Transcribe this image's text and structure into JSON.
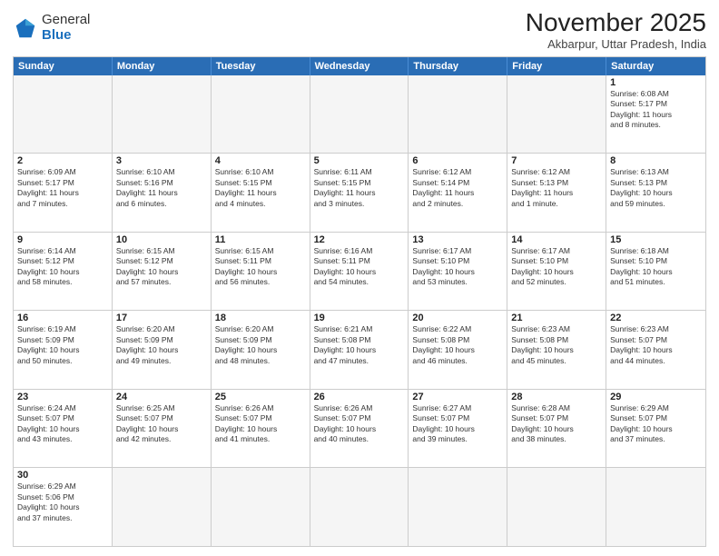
{
  "header": {
    "logo_general": "General",
    "logo_blue": "Blue",
    "month_title": "November 2025",
    "location": "Akbarpur, Uttar Pradesh, India"
  },
  "day_headers": [
    "Sunday",
    "Monday",
    "Tuesday",
    "Wednesday",
    "Thursday",
    "Friday",
    "Saturday"
  ],
  "weeks": [
    {
      "days": [
        {
          "num": "",
          "info": "",
          "empty": true
        },
        {
          "num": "",
          "info": "",
          "empty": true
        },
        {
          "num": "",
          "info": "",
          "empty": true
        },
        {
          "num": "",
          "info": "",
          "empty": true
        },
        {
          "num": "",
          "info": "",
          "empty": true
        },
        {
          "num": "",
          "info": "",
          "empty": true
        },
        {
          "num": "1",
          "info": "Sunrise: 6:08 AM\nSunset: 5:17 PM\nDaylight: 11 hours\nand 8 minutes.",
          "empty": false
        }
      ]
    },
    {
      "days": [
        {
          "num": "2",
          "info": "Sunrise: 6:09 AM\nSunset: 5:17 PM\nDaylight: 11 hours\nand 7 minutes.",
          "empty": false
        },
        {
          "num": "3",
          "info": "Sunrise: 6:10 AM\nSunset: 5:16 PM\nDaylight: 11 hours\nand 6 minutes.",
          "empty": false
        },
        {
          "num": "4",
          "info": "Sunrise: 6:10 AM\nSunset: 5:15 PM\nDaylight: 11 hours\nand 4 minutes.",
          "empty": false
        },
        {
          "num": "5",
          "info": "Sunrise: 6:11 AM\nSunset: 5:15 PM\nDaylight: 11 hours\nand 3 minutes.",
          "empty": false
        },
        {
          "num": "6",
          "info": "Sunrise: 6:12 AM\nSunset: 5:14 PM\nDaylight: 11 hours\nand 2 minutes.",
          "empty": false
        },
        {
          "num": "7",
          "info": "Sunrise: 6:12 AM\nSunset: 5:13 PM\nDaylight: 11 hours\nand 1 minute.",
          "empty": false
        },
        {
          "num": "8",
          "info": "Sunrise: 6:13 AM\nSunset: 5:13 PM\nDaylight: 10 hours\nand 59 minutes.",
          "empty": false
        }
      ]
    },
    {
      "days": [
        {
          "num": "9",
          "info": "Sunrise: 6:14 AM\nSunset: 5:12 PM\nDaylight: 10 hours\nand 58 minutes.",
          "empty": false
        },
        {
          "num": "10",
          "info": "Sunrise: 6:15 AM\nSunset: 5:12 PM\nDaylight: 10 hours\nand 57 minutes.",
          "empty": false
        },
        {
          "num": "11",
          "info": "Sunrise: 6:15 AM\nSunset: 5:11 PM\nDaylight: 10 hours\nand 56 minutes.",
          "empty": false
        },
        {
          "num": "12",
          "info": "Sunrise: 6:16 AM\nSunset: 5:11 PM\nDaylight: 10 hours\nand 54 minutes.",
          "empty": false
        },
        {
          "num": "13",
          "info": "Sunrise: 6:17 AM\nSunset: 5:10 PM\nDaylight: 10 hours\nand 53 minutes.",
          "empty": false
        },
        {
          "num": "14",
          "info": "Sunrise: 6:17 AM\nSunset: 5:10 PM\nDaylight: 10 hours\nand 52 minutes.",
          "empty": false
        },
        {
          "num": "15",
          "info": "Sunrise: 6:18 AM\nSunset: 5:10 PM\nDaylight: 10 hours\nand 51 minutes.",
          "empty": false
        }
      ]
    },
    {
      "days": [
        {
          "num": "16",
          "info": "Sunrise: 6:19 AM\nSunset: 5:09 PM\nDaylight: 10 hours\nand 50 minutes.",
          "empty": false
        },
        {
          "num": "17",
          "info": "Sunrise: 6:20 AM\nSunset: 5:09 PM\nDaylight: 10 hours\nand 49 minutes.",
          "empty": false
        },
        {
          "num": "18",
          "info": "Sunrise: 6:20 AM\nSunset: 5:09 PM\nDaylight: 10 hours\nand 48 minutes.",
          "empty": false
        },
        {
          "num": "19",
          "info": "Sunrise: 6:21 AM\nSunset: 5:08 PM\nDaylight: 10 hours\nand 47 minutes.",
          "empty": false
        },
        {
          "num": "20",
          "info": "Sunrise: 6:22 AM\nSunset: 5:08 PM\nDaylight: 10 hours\nand 46 minutes.",
          "empty": false
        },
        {
          "num": "21",
          "info": "Sunrise: 6:23 AM\nSunset: 5:08 PM\nDaylight: 10 hours\nand 45 minutes.",
          "empty": false
        },
        {
          "num": "22",
          "info": "Sunrise: 6:23 AM\nSunset: 5:07 PM\nDaylight: 10 hours\nand 44 minutes.",
          "empty": false
        }
      ]
    },
    {
      "days": [
        {
          "num": "23",
          "info": "Sunrise: 6:24 AM\nSunset: 5:07 PM\nDaylight: 10 hours\nand 43 minutes.",
          "empty": false
        },
        {
          "num": "24",
          "info": "Sunrise: 6:25 AM\nSunset: 5:07 PM\nDaylight: 10 hours\nand 42 minutes.",
          "empty": false
        },
        {
          "num": "25",
          "info": "Sunrise: 6:26 AM\nSunset: 5:07 PM\nDaylight: 10 hours\nand 41 minutes.",
          "empty": false
        },
        {
          "num": "26",
          "info": "Sunrise: 6:26 AM\nSunset: 5:07 PM\nDaylight: 10 hours\nand 40 minutes.",
          "empty": false
        },
        {
          "num": "27",
          "info": "Sunrise: 6:27 AM\nSunset: 5:07 PM\nDaylight: 10 hours\nand 39 minutes.",
          "empty": false
        },
        {
          "num": "28",
          "info": "Sunrise: 6:28 AM\nSunset: 5:07 PM\nDaylight: 10 hours\nand 38 minutes.",
          "empty": false
        },
        {
          "num": "29",
          "info": "Sunrise: 6:29 AM\nSunset: 5:07 PM\nDaylight: 10 hours\nand 37 minutes.",
          "empty": false
        }
      ]
    },
    {
      "days": [
        {
          "num": "30",
          "info": "Sunrise: 6:29 AM\nSunset: 5:06 PM\nDaylight: 10 hours\nand 37 minutes.",
          "empty": false
        },
        {
          "num": "",
          "info": "",
          "empty": true
        },
        {
          "num": "",
          "info": "",
          "empty": true
        },
        {
          "num": "",
          "info": "",
          "empty": true
        },
        {
          "num": "",
          "info": "",
          "empty": true
        },
        {
          "num": "",
          "info": "",
          "empty": true
        },
        {
          "num": "",
          "info": "",
          "empty": true
        }
      ]
    }
  ]
}
